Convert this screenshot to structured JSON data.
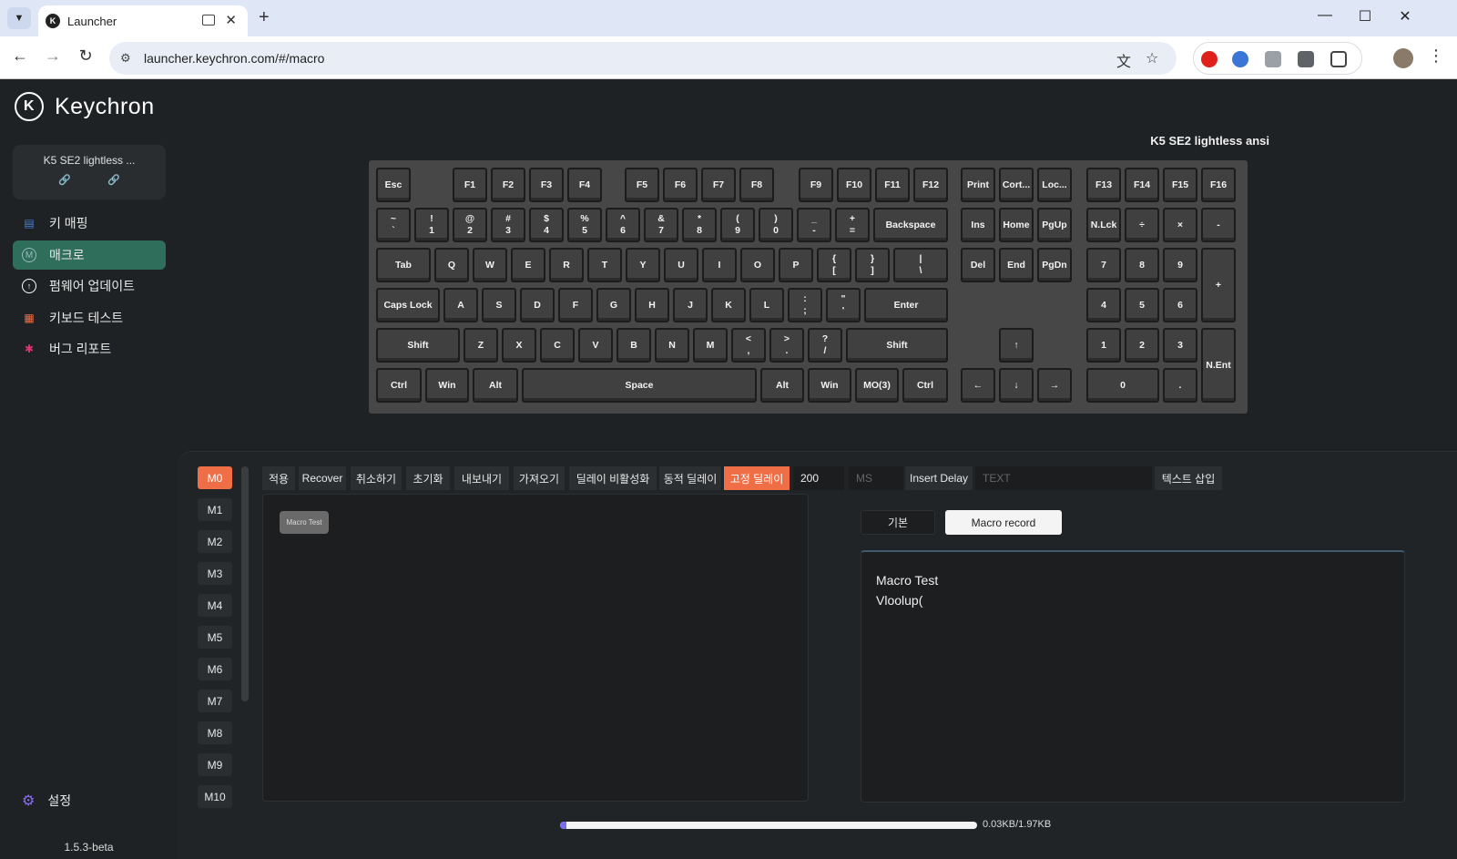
{
  "browser": {
    "tab_title": "Launcher",
    "url": "launcher.keychron.com/#/macro"
  },
  "app": {
    "brand": "Keychron",
    "device_name": "K5 SE2 lightless ...",
    "nav": [
      "키 매핑",
      "매크로",
      "펌웨어 업데이트",
      "키보드 테스트",
      "버그 리포트"
    ],
    "settings_label": "설정",
    "version": "1.5.3-beta"
  },
  "keyboard_title": "K5 SE2 lightless ansi",
  "macro_slots": [
    "M0",
    "M1",
    "M2",
    "M3",
    "M4",
    "M5",
    "M6",
    "M7",
    "M8",
    "M9",
    "M10"
  ],
  "active_slot": "M0",
  "toolbar": {
    "apply": "적용",
    "recover": "Recover",
    "undo": "취소하기",
    "reset": "초기화",
    "export": "내보내기",
    "import": "가져오기",
    "disable_delay": "딜레이 비활성화",
    "dynamic_delay": "동적 딜레이",
    "fixed_delay": "고정 딜레이",
    "delay_value": "200",
    "ms_placeholder": "MS",
    "insert_delay": "Insert Delay",
    "text_placeholder": "TEXT",
    "insert_text": "텍스트 삽입"
  },
  "editor_chip": "Macro Test",
  "mode_tabs": {
    "basic": "기본",
    "record": "Macro record"
  },
  "textarea_lines": [
    "Macro Test",
    "Vloolup("
  ],
  "storage": {
    "used_fraction": 0.015,
    "label": "0.03KB/1.97KB"
  }
}
